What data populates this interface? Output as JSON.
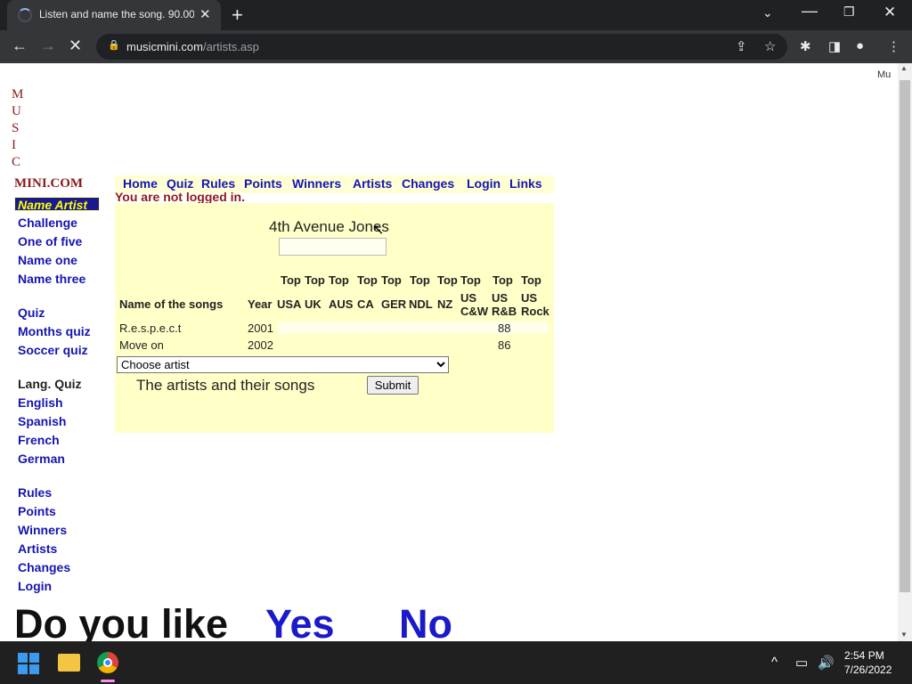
{
  "browser": {
    "tab_title": "Listen and name the song. 90.000",
    "tab_close": "✕",
    "new_tab": "+",
    "url_domain": "musicmini.com",
    "url_path": "/artists.asp",
    "icons": [
      "loading-spinner-icon",
      "close-icon",
      "plus-icon",
      "chevron-down-icon",
      "minimize-icon",
      "restore-icon",
      "back-icon",
      "forward-icon",
      "stop-icon",
      "lock-icon",
      "share-icon",
      "star-icon",
      "extensions-icon",
      "sidepanel-icon",
      "profile-icon",
      "menu-icon"
    ]
  },
  "logo": {
    "letters": [
      "M",
      "U",
      "S",
      "I",
      "C"
    ],
    "domain": "MINI.COM"
  },
  "top_corner": "Mu",
  "sidebar": {
    "highlight": "Name Artist",
    "group1": [
      "Challenge",
      "One of five",
      "Name one",
      "Name three"
    ],
    "group2": [
      "Quiz",
      "Months quiz",
      "Soccer quiz"
    ],
    "lang_heading": "Lang. Quiz",
    "group3": [
      "English",
      "Spanish",
      "French",
      "German"
    ],
    "group4": [
      "Rules",
      "Points",
      "Winners",
      "Artists",
      "Changes",
      "Login"
    ]
  },
  "nav": [
    "Home",
    "Quiz",
    "Rules",
    "Points",
    "Winners",
    "Artists",
    "Changes",
    "Login",
    "Links"
  ],
  "login_status": "You are not logged in.",
  "artist": {
    "name": "4th Avenue Jones"
  },
  "table": {
    "top_label": "Top",
    "col_songs": "Name of the songs",
    "col_year": "Year",
    "countries": [
      "USA",
      "UK",
      "AUS",
      "CA",
      "GER",
      "NDL",
      "NZ"
    ],
    "col_uscw": [
      "US",
      "C&W"
    ],
    "col_usrb": [
      "US",
      "R&B"
    ],
    "col_usrock": [
      "US",
      "Rock"
    ],
    "rows": [
      {
        "song": "R.e.s.p.e.c.t",
        "year": "2001",
        "usrb": "88"
      },
      {
        "song": "Move on",
        "year": "2002",
        "usrb": "86"
      }
    ]
  },
  "form": {
    "select_value": "Choose artist",
    "songs_label": "The artists and their songs",
    "submit": "Submit"
  },
  "promo": {
    "question": "Do you like",
    "yes": "Yes",
    "no": "No"
  },
  "taskbar": {
    "time": "2:54 PM",
    "date": "7/26/2022",
    "icons": [
      "windows-start-icon",
      "file-explorer-icon",
      "chrome-icon",
      "chevron-up-icon",
      "network-icon",
      "volume-icon"
    ]
  }
}
